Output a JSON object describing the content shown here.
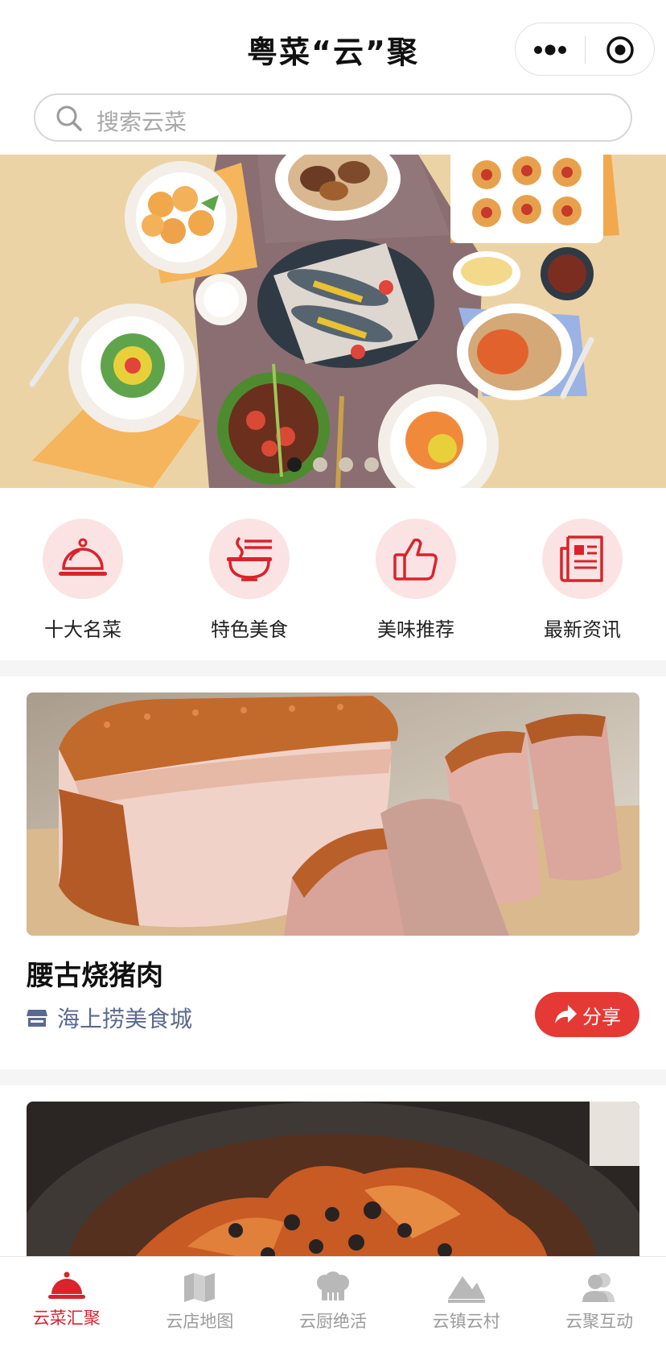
{
  "header": {
    "title": "粤菜“云”聚"
  },
  "search": {
    "placeholder": "搜索云菜"
  },
  "banner": {
    "dot_count": 4,
    "active_dot": 0
  },
  "categories": [
    {
      "label": "十大名菜",
      "icon": "cloche-icon"
    },
    {
      "label": "特色美食",
      "icon": "noodle-bowl-icon"
    },
    {
      "label": "美味推荐",
      "icon": "thumbs-up-icon"
    },
    {
      "label": "最新资讯",
      "icon": "news-icon"
    }
  ],
  "cards": [
    {
      "title": "腰古烧猪肉",
      "shop": "海上捞美食城",
      "share_label": "分享"
    }
  ],
  "tabbar": {
    "items": [
      {
        "label": "云菜汇聚",
        "icon": "cloche-icon",
        "active": true
      },
      {
        "label": "云店地图",
        "icon": "map-icon",
        "active": false
      },
      {
        "label": "云厨绝活",
        "icon": "chef-hat-icon",
        "active": false
      },
      {
        "label": "云镇云村",
        "icon": "mountain-icon",
        "active": false
      },
      {
        "label": "云聚互动",
        "icon": "users-icon",
        "active": false
      }
    ]
  },
  "colors": {
    "accent": "#e53935",
    "tab_active": "#d9232d",
    "tab_inactive": "#9b9b9b",
    "category_bg": "#fbe3e3"
  }
}
